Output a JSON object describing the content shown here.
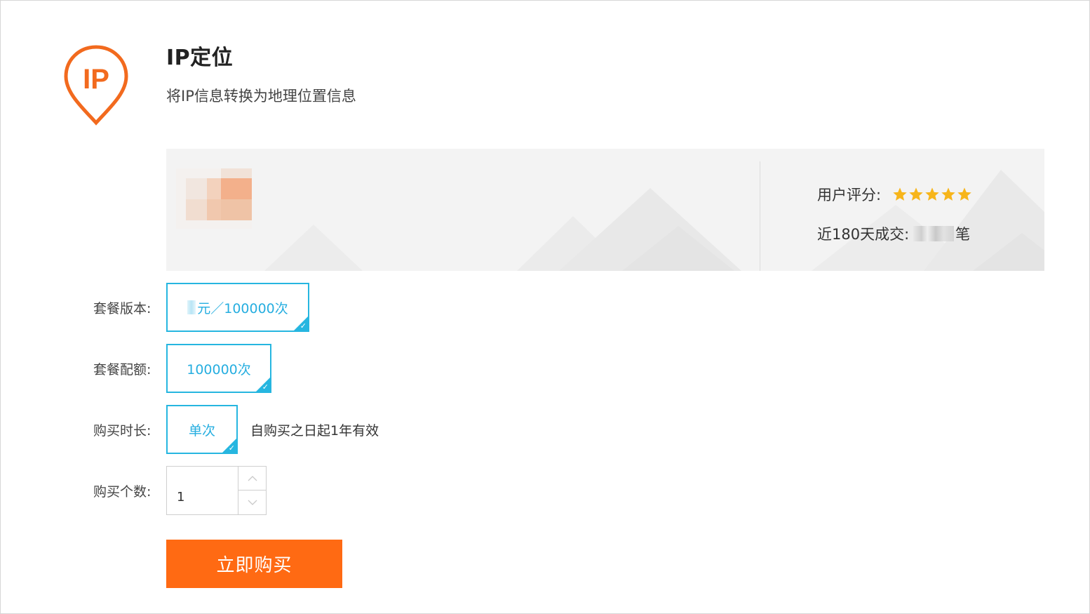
{
  "product": {
    "title": "IP定位",
    "subtitle": "将IP信息转换为地理位置信息",
    "logo_text": "IP"
  },
  "stats": {
    "rating_label": "用户评分:",
    "rating_stars": 5,
    "deals_label": "近180天成交:",
    "deals_unit": "笔"
  },
  "form": {
    "version_label": "套餐版本:",
    "version_option": "元／100000次",
    "quota_label": "套餐配额:",
    "quota_option": "100000次",
    "duration_label": "购买时长:",
    "duration_option": "单次",
    "duration_note": "自购买之日起1年有效",
    "count_label": "购买个数:",
    "count_value": "1"
  },
  "actions": {
    "buy_label": "立即购买"
  },
  "colors": {
    "accent": "#ff6a13",
    "selected": "#26b6e0",
    "star": "#f7b51a"
  },
  "icons": {
    "logo": "ip-location-pin-icon",
    "up": "chevron-up-icon",
    "down": "chevron-down-icon",
    "check": "check-icon",
    "star": "star-icon"
  }
}
